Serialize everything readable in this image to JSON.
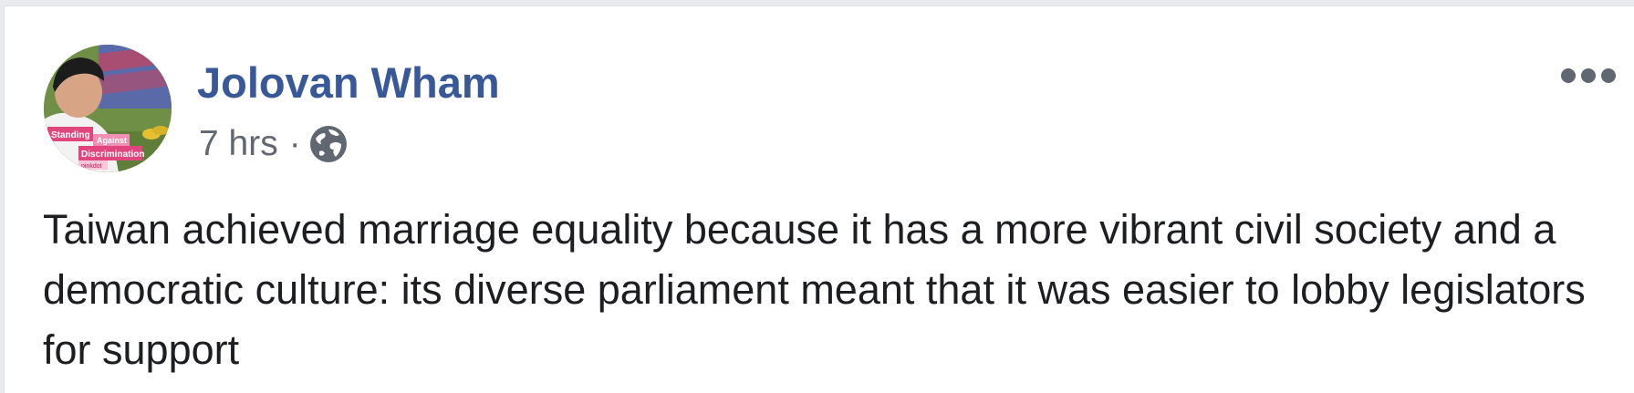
{
  "post": {
    "author": {
      "name": "Jolovan Wham",
      "avatar_frame_text": {
        "line1": "Standing",
        "line2": "Against",
        "line3": "Discrimination",
        "line4": "pinkdot"
      }
    },
    "timestamp": "7 hrs",
    "separator": "·",
    "privacy_icon": "globe-icon",
    "more_icon": "more-options-icon",
    "text": "Taiwan achieved marriage equality because it has a more vibrant civil society and a democratic culture: its diverse parliament meant that it was easier to lobby legislators for support"
  },
  "colors": {
    "author_name": "#385898",
    "meta_text": "#606770",
    "body_text": "#1c1e21",
    "card_background": "#ffffff",
    "page_background": "#e9ebee",
    "frame_pink": "#e0457b"
  }
}
